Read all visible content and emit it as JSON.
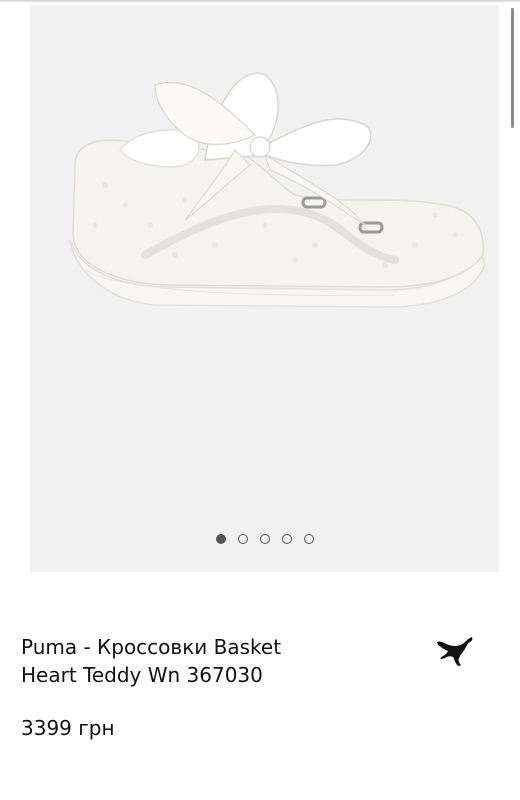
{
  "product": {
    "title_line1": "Puma - Кроссовки Basket",
    "title_line2": "Heart Teddy Wn 367030",
    "price": "3399 грн",
    "brand_logo_icon": "puma-cat-icon"
  },
  "gallery": {
    "image_icon": "white-sneaker-image",
    "dots_count": 5,
    "active_dot": 1,
    "background_color": "#f1f1f1"
  }
}
